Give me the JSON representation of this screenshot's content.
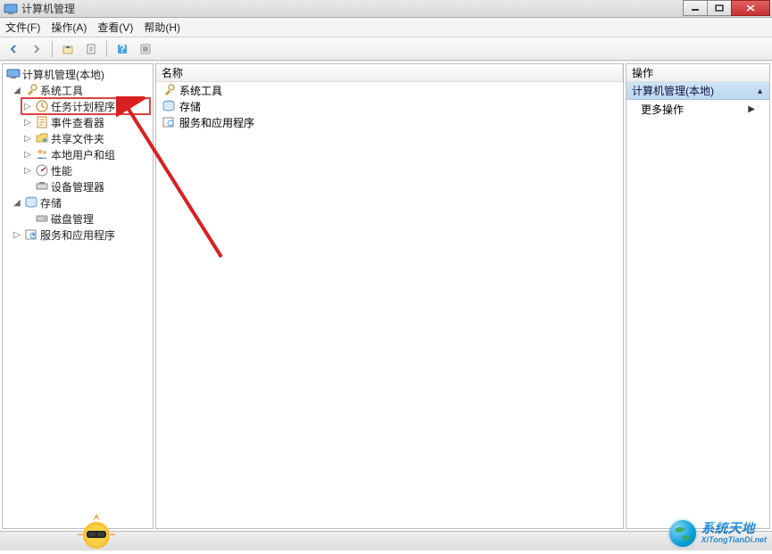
{
  "window": {
    "title": "计算机管理"
  },
  "menu": {
    "file": "文件(F)",
    "action": "操作(A)",
    "view": "查看(V)",
    "help": "帮助(H)"
  },
  "tree": {
    "root": "计算机管理(本地)",
    "system_tools": "系统工具",
    "task_scheduler": "任务计划程序",
    "event_viewer": "事件查看器",
    "shared_folders": "共享文件夹",
    "local_users": "本地用户和组",
    "performance": "性能",
    "device_manager": "设备管理器",
    "storage": "存储",
    "disk_mgmt": "磁盘管理",
    "services_apps": "服务和应用程序"
  },
  "list": {
    "header_name": "名称",
    "items": {
      "system_tools": "系统工具",
      "storage": "存储",
      "services_apps": "服务和应用程序"
    }
  },
  "actions": {
    "header": "操作",
    "section": "计算机管理(本地)",
    "more": "更多操作"
  },
  "watermark": {
    "cn": "系统天地",
    "en": "XiTongTianDi.net"
  }
}
